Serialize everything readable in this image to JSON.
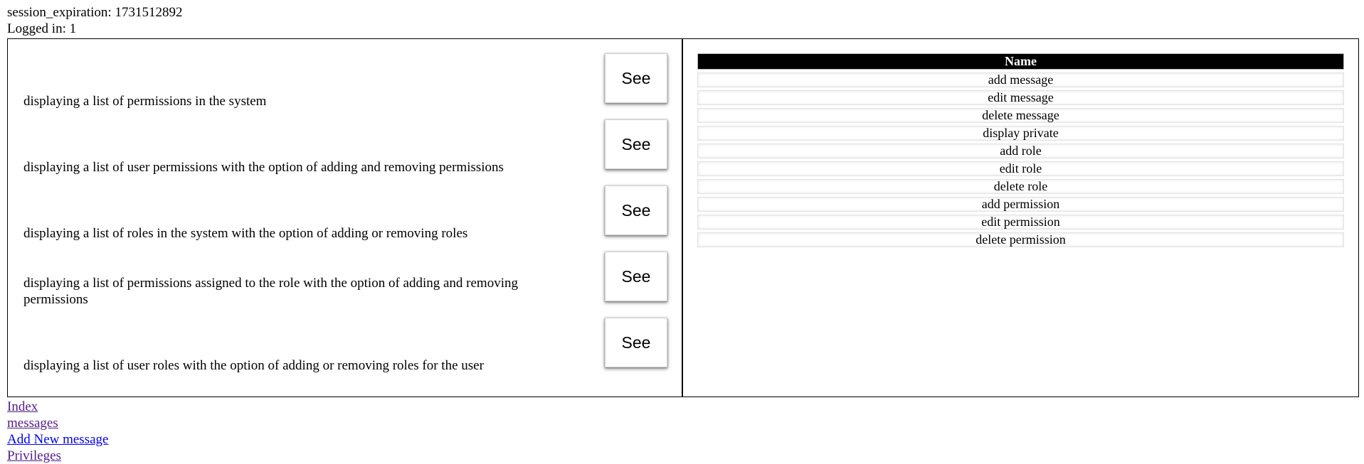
{
  "session": {
    "expiration_label": "session_expiration: 1731512892",
    "logged_in_label": "Logged in: 1"
  },
  "features": [
    {
      "description": "displaying a list of permissions in the system",
      "button_label": "See"
    },
    {
      "description": "displaying a list of user permissions with the option of adding and removing permissions",
      "button_label": "See"
    },
    {
      "description": "displaying a list of roles in the system with the option of adding or removing roles",
      "button_label": "See"
    },
    {
      "description": "displaying a list of permissions assigned to the role with the option of adding and removing permissions",
      "button_label": "See"
    },
    {
      "description": "displaying a list of user roles with the option of adding or removing roles for the user",
      "button_label": "See"
    }
  ],
  "permissions_table": {
    "header": "Name",
    "rows": [
      "add message",
      "edit message",
      "delete message",
      "display private",
      "add role",
      "edit role",
      "delete role",
      "add permission",
      "edit permission",
      "delete permission"
    ]
  },
  "nav_links": [
    {
      "label": "Index",
      "visited": true
    },
    {
      "label": "messages",
      "visited": true
    },
    {
      "label": "Add New message",
      "visited": false
    },
    {
      "label": "Privileges",
      "visited": true
    }
  ],
  "colors": {
    "visited_link": "#551a8b",
    "unvisited_link": "#0000ee",
    "table_header_bg": "#000000",
    "table_header_text": "#ffffff"
  }
}
